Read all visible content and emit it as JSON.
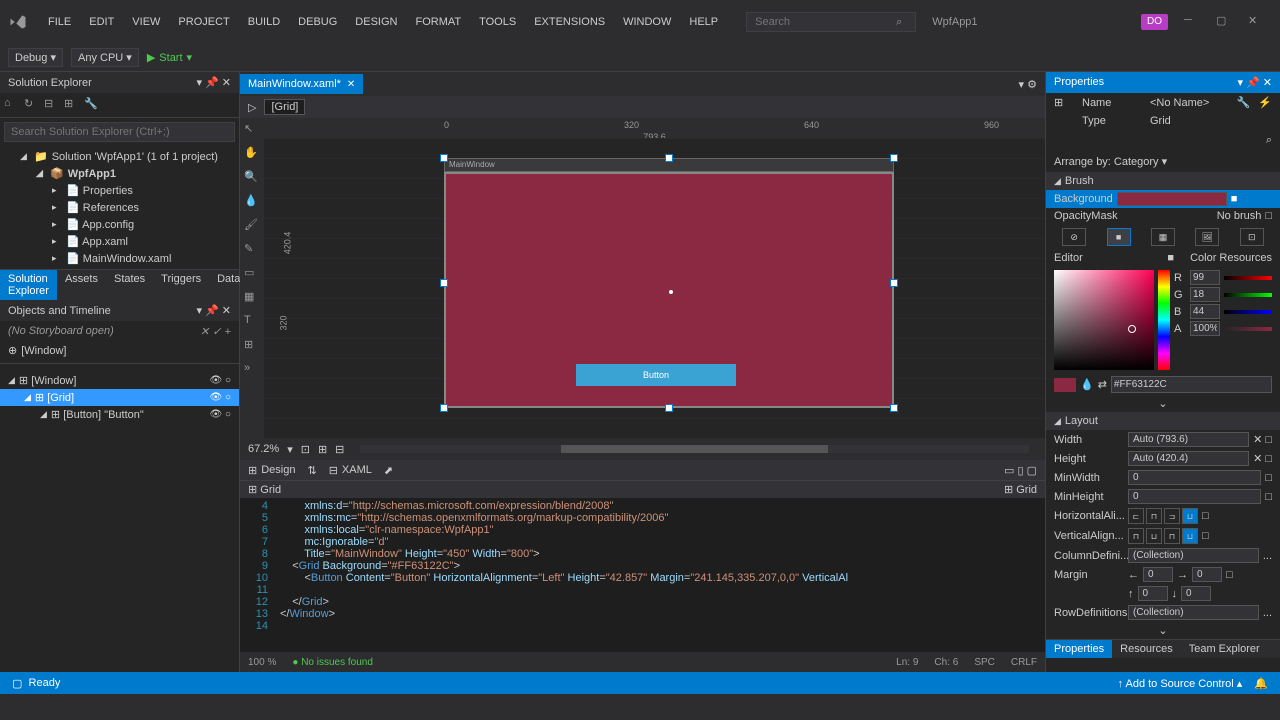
{
  "menu": [
    "FILE",
    "EDIT",
    "VIEW",
    "PROJECT",
    "BUILD",
    "DEBUG",
    "DESIGN",
    "FORMAT",
    "TOOLS",
    "EXTENSIONS",
    "WINDOW",
    "HELP"
  ],
  "search_placeholder": "Search",
  "app_title": "WpfApp1",
  "user_initials": "DO",
  "toolbar": {
    "config": "Debug",
    "platform": "Any CPU",
    "start": "Start"
  },
  "solution_explorer": {
    "title": "Solution Explorer",
    "search": "Search Solution Explorer (Ctrl+;)",
    "solution": "Solution 'WpfApp1' (1 of 1 project)",
    "project": "WpfApp1",
    "items": [
      "Properties",
      "References",
      "App.config",
      "App.xaml",
      "MainWindow.xaml"
    ],
    "tabs": [
      "Solution Explorer",
      "Assets",
      "States",
      "Triggers",
      "Data"
    ]
  },
  "timeline": {
    "title": "Objects and Timeline",
    "info": "(No Storyboard open)",
    "root": "[Window]",
    "items": [
      {
        "label": "[Window]",
        "indent": 0,
        "selected": false
      },
      {
        "label": "[Grid]",
        "indent": 1,
        "selected": true
      },
      {
        "label": "[Button] \"Button\"",
        "indent": 2,
        "selected": false
      }
    ]
  },
  "document": {
    "tab": "MainWindow.xaml*",
    "breadcrumb": "[Grid]",
    "canvas_size": "793.6",
    "ruler_ticks": [
      "0",
      "320",
      "640",
      "960"
    ],
    "side_label": "420.4",
    "rot_label": "320",
    "window_title": "MainWindow",
    "button_text": "Button",
    "zoom": "67.2%",
    "design_label": "Design",
    "xaml_label": "XAML",
    "nav_left": "Grid",
    "nav_right": "Grid"
  },
  "code": {
    "lines": [
      {
        "n": 4,
        "html": "        <span class='c-attr'>xmlns:d</span>=<span class='c-str'>\"http://schemas.microsoft.com/expression/blend/2008\"</span>"
      },
      {
        "n": 5,
        "html": "        <span class='c-attr'>xmlns:mc</span>=<span class='c-str'>\"http://schemas.openxmlformats.org/markup-compatibility/2006\"</span>"
      },
      {
        "n": 6,
        "html": "        <span class='c-attr'>xmlns:local</span>=<span class='c-str'>\"clr-namespace:WpfApp1\"</span>"
      },
      {
        "n": 7,
        "html": "        <span class='c-attr'>mc:Ignorable</span>=<span class='c-str'>\"d\"</span>"
      },
      {
        "n": 8,
        "html": "        <span class='c-attr'>Title</span>=<span class='c-str'>\"MainWindow\"</span> <span class='c-attr'>Height</span>=<span class='c-str'>\"450\"</span> <span class='c-attr'>Width</span>=<span class='c-str'>\"800\"</span>&gt;"
      },
      {
        "n": 9,
        "html": "    &lt;<span class='c-blue'>Grid</span> <span class='c-attr'>Background</span>=<span class='c-str'>\"#FF63122C\"</span>&gt;"
      },
      {
        "n": 10,
        "html": "        &lt;<span class='c-blue'>Button</span> <span class='c-attr'>Content</span>=<span class='c-str'>\"Button\"</span> <span class='c-attr'>HorizontalAlignment</span>=<span class='c-str'>\"Left\"</span> <span class='c-attr'>Height</span>=<span class='c-str'>\"42.857\"</span> <span class='c-attr'>Margin</span>=<span class='c-str'>\"241.145,335.207,0,0\"</span> <span class='c-attr'>VerticalAl</span>"
      },
      {
        "n": 11,
        "html": ""
      },
      {
        "n": 12,
        "html": "    &lt;/<span class='c-blue'>Grid</span>&gt;"
      },
      {
        "n": 13,
        "html": "&lt;/<span class='c-blue'>Window</span>&gt;"
      },
      {
        "n": 14,
        "html": ""
      }
    ],
    "status": {
      "zoom": "100 %",
      "issues": "No issues found",
      "ln": "Ln: 9",
      "ch": "Ch: 6",
      "spc": "SPC",
      "crlf": "CRLF"
    }
  },
  "properties": {
    "title": "Properties",
    "name_label": "Name",
    "name_value": "<No Name>",
    "type_label": "Type",
    "type_value": "Grid",
    "arrange": "Arrange by: Category",
    "brush": {
      "title": "Brush",
      "background": "Background",
      "opacity": "OpacityMask",
      "nobrush": "No brush",
      "editor": "Editor",
      "color_res": "Color Resources",
      "r": "99",
      "g": "18",
      "b": "44",
      "a": "100%",
      "hex": "#FF63122C",
      "bg_color": "#8b2942"
    },
    "layout": {
      "title": "Layout",
      "width": "Auto (793.6)",
      "height": "Auto (420.4)",
      "minwidth": "0",
      "minheight": "0",
      "halign": "HorizontalAli...",
      "valign": "VerticalAlign...",
      "coldef": "ColumnDefini...",
      "collection": "(Collection)",
      "margin": "Margin",
      "m1": "0",
      "m2": "0",
      "m3": "0",
      "m4": "0",
      "rowdef": "RowDefinitions"
    },
    "tabs": [
      "Properties",
      "Resources",
      "Team Explorer"
    ]
  },
  "statusbar": {
    "ready": "Ready",
    "source_control": "Add to Source Control"
  }
}
